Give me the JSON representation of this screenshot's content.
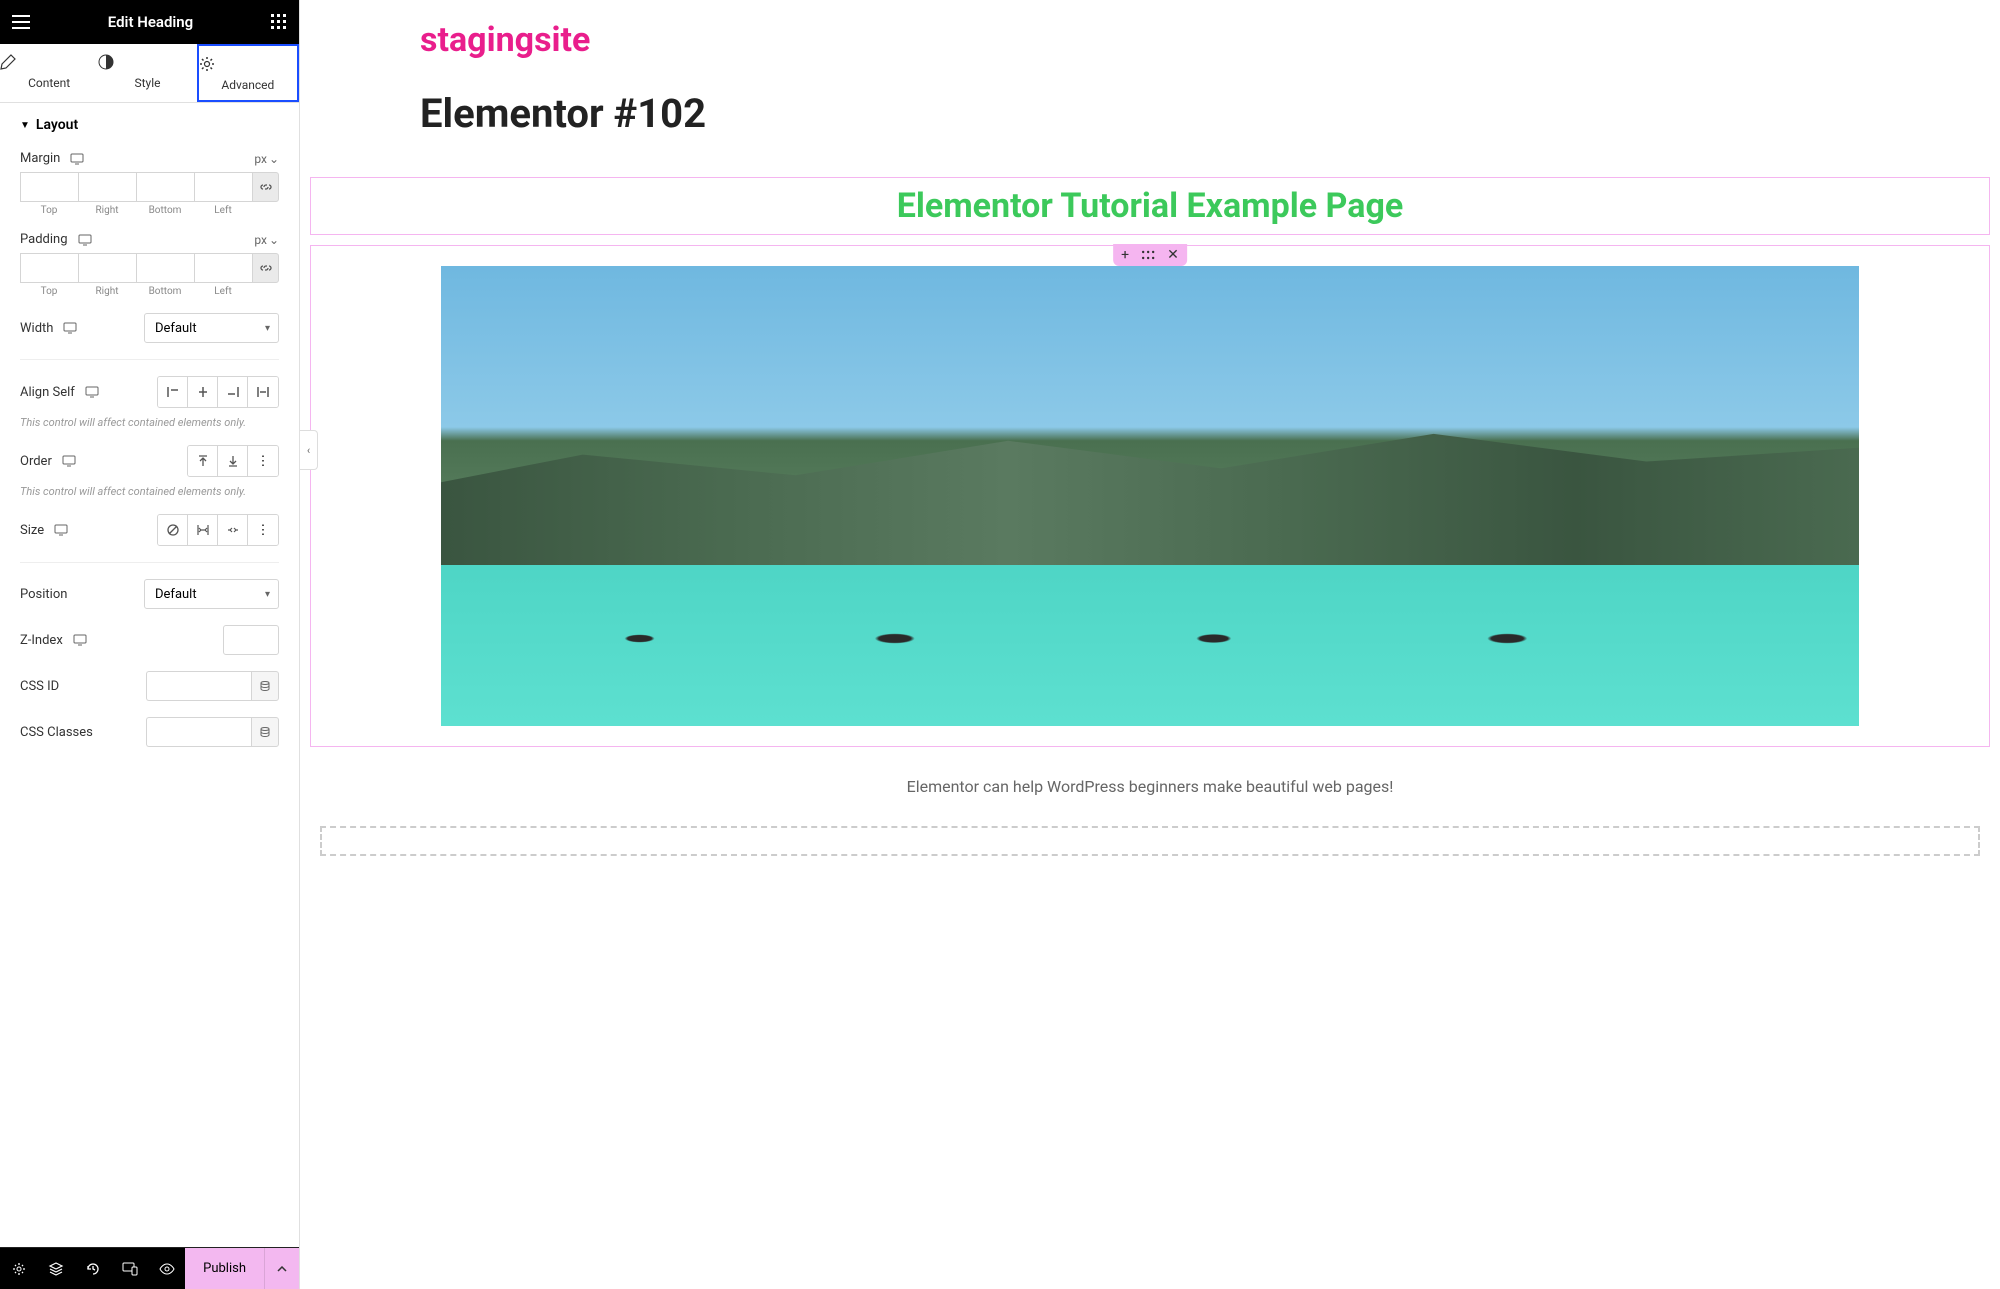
{
  "header": {
    "title": "Edit Heading"
  },
  "tabs": [
    {
      "label": "Content"
    },
    {
      "label": "Style"
    },
    {
      "label": "Advanced"
    }
  ],
  "section": {
    "layout_title": "Layout"
  },
  "controls": {
    "margin": {
      "label": "Margin",
      "unit": "px"
    },
    "padding": {
      "label": "Padding",
      "unit": "px"
    },
    "dim_labels": {
      "top": "Top",
      "right": "Right",
      "bottom": "Bottom",
      "left": "Left"
    },
    "width": {
      "label": "Width",
      "value": "Default"
    },
    "align_self": {
      "label": "Align Self"
    },
    "align_helper": "This control will affect contained elements only.",
    "order": {
      "label": "Order"
    },
    "order_helper": "This control will affect contained elements only.",
    "size": {
      "label": "Size"
    },
    "position": {
      "label": "Position",
      "value": "Default"
    },
    "zindex": {
      "label": "Z-Index"
    },
    "css_id": {
      "label": "CSS ID"
    },
    "css_classes": {
      "label": "CSS Classes"
    }
  },
  "footer": {
    "publish": "Publish"
  },
  "canvas": {
    "site_title": "stagingsite",
    "page_title": "Elementor #102",
    "heading": "Elementor Tutorial Example Page",
    "caption": "Elementor can help WordPress beginners make beautiful web pages!"
  }
}
